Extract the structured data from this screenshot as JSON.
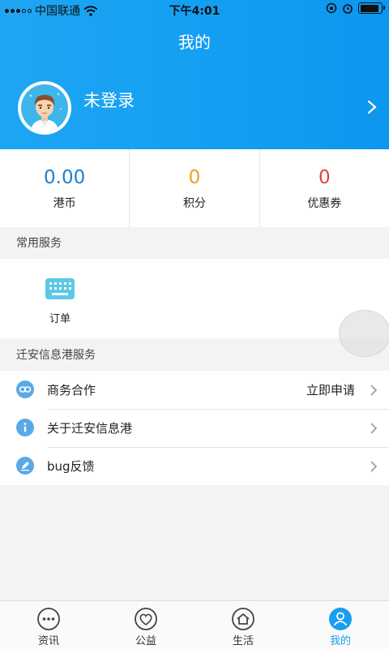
{
  "status_bar": {
    "carrier": "中国联通",
    "time": "下午4:01",
    "battery_percent": 90
  },
  "header": {
    "title": "我的",
    "username": "未登录"
  },
  "stats": [
    {
      "value": "0.00",
      "label": "港币",
      "color": "#1d7fd0"
    },
    {
      "value": "0",
      "label": "积分",
      "color": "#f0a020"
    },
    {
      "value": "0",
      "label": "优惠券",
      "color": "#e0433a"
    }
  ],
  "common_services": {
    "title": "常用服务",
    "items": [
      {
        "label": "订单",
        "icon": "keyboard-icon"
      }
    ]
  },
  "info_services": {
    "title": "迁安信息港服务",
    "rows": [
      {
        "label": "商务合作",
        "value": "立即申请",
        "icon": "link-icon"
      },
      {
        "label": "关于迁安信息港",
        "value": "",
        "icon": "info-icon"
      },
      {
        "label": "bug反馈",
        "value": "",
        "icon": "edit-icon"
      }
    ]
  },
  "tabbar": {
    "tabs": [
      {
        "label": "资讯",
        "icon": "chat-bubble-icon"
      },
      {
        "label": "公益",
        "icon": "heart-icon"
      },
      {
        "label": "生活",
        "icon": "house-icon"
      },
      {
        "label": "我的",
        "icon": "person-icon",
        "active": true
      }
    ]
  },
  "colors": {
    "accent": "#1a9ef0",
    "row_icon": "#5aa9e6"
  }
}
